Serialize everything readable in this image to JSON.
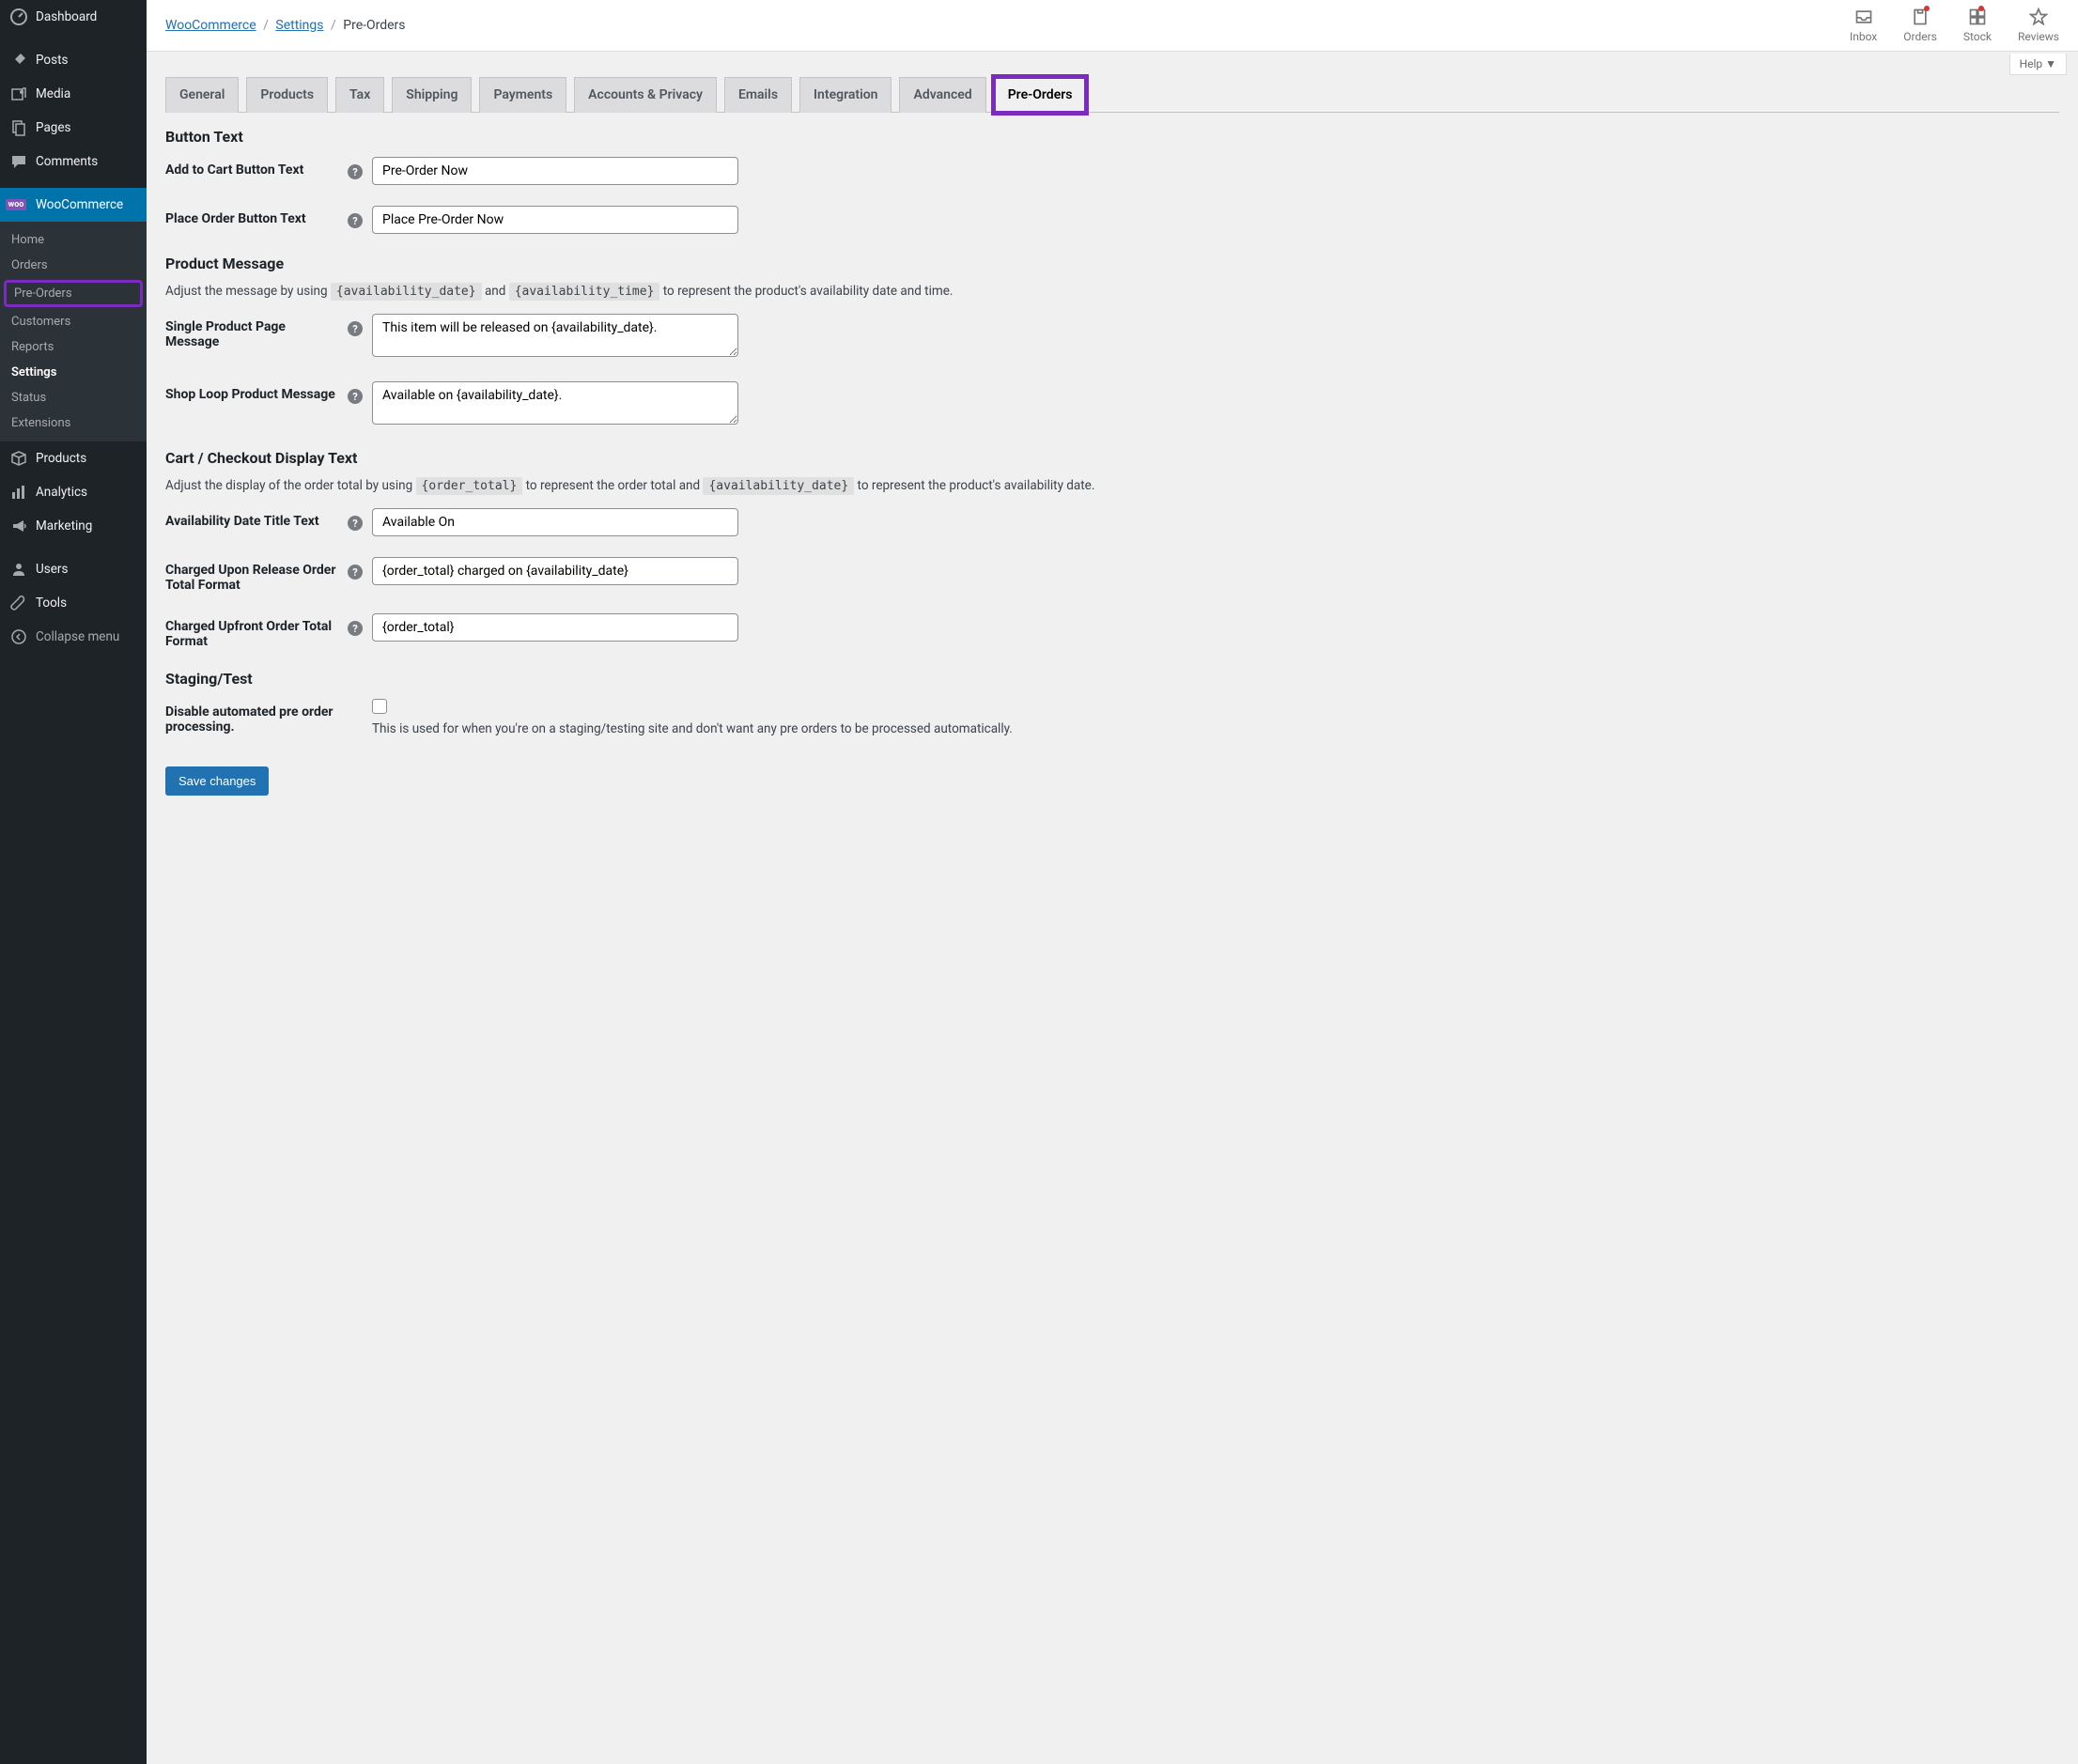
{
  "sidebar": {
    "items": [
      {
        "label": "Dashboard",
        "icon": "dashboard"
      },
      {
        "label": "Posts",
        "icon": "pin"
      },
      {
        "label": "Media",
        "icon": "media"
      },
      {
        "label": "Pages",
        "icon": "pages"
      },
      {
        "label": "Comments",
        "icon": "comments"
      },
      {
        "label": "WooCommerce",
        "icon": "woo",
        "active": true
      },
      {
        "label": "Products",
        "icon": "products"
      },
      {
        "label": "Analytics",
        "icon": "analytics"
      },
      {
        "label": "Marketing",
        "icon": "marketing"
      },
      {
        "label": "Users",
        "icon": "users"
      },
      {
        "label": "Tools",
        "icon": "tools"
      },
      {
        "label": "Collapse menu",
        "icon": "collapse"
      }
    ],
    "sub": [
      "Home",
      "Orders",
      "Pre-Orders",
      "Customers",
      "Reports",
      "Settings",
      "Status",
      "Extensions"
    ]
  },
  "breadcrumb": {
    "a": "WooCommerce",
    "b": "Settings",
    "c": "Pre-Orders"
  },
  "topicons": [
    "Inbox",
    "Orders",
    "Stock",
    "Reviews"
  ],
  "help_label": "Help ▼",
  "tabs": [
    "General",
    "Products",
    "Tax",
    "Shipping",
    "Payments",
    "Accounts & Privacy",
    "Emails",
    "Integration",
    "Advanced",
    "Pre-Orders"
  ],
  "sections": {
    "button_text": {
      "title": "Button Text",
      "fields": {
        "add_to_cart": {
          "label": "Add to Cart Button Text",
          "value": "Pre-Order Now"
        },
        "place_order": {
          "label": "Place Order Button Text",
          "value": "Place Pre-Order Now"
        }
      }
    },
    "product_message": {
      "title": "Product Message",
      "desc_pre": "Adjust the message by using ",
      "code1": "{availability_date}",
      "desc_mid": " and ",
      "code2": "{availability_time}",
      "desc_post": " to represent the product's availability date and time.",
      "fields": {
        "single": {
          "label": "Single Product Page Message",
          "value": "This item will be released on {availability_date}."
        },
        "loop": {
          "label": "Shop Loop Product Message",
          "value": "Available on {availability_date}."
        }
      }
    },
    "cart_checkout": {
      "title": "Cart / Checkout Display Text",
      "desc_pre": "Adjust the display of the order total by using ",
      "code1": "{order_total}",
      "desc_mid": " to represent the order total and ",
      "code2": "{availability_date}",
      "desc_post": " to represent the product's availability date.",
      "fields": {
        "avail_title": {
          "label": "Availability Date Title Text",
          "value": "Available On"
        },
        "charged_release": {
          "label": "Charged Upon Release Order Total Format",
          "value": "{order_total} charged on {availability_date}"
        },
        "charged_upfront": {
          "label": "Charged Upfront Order Total Format",
          "value": "{order_total}"
        }
      }
    },
    "staging": {
      "title": "Staging/Test",
      "fields": {
        "disable": {
          "label": "Disable automated pre order processing.",
          "hint": "This is used for when you're on a staging/testing site and don't want any pre orders to be processed automatically."
        }
      }
    }
  },
  "save_label": "Save changes"
}
